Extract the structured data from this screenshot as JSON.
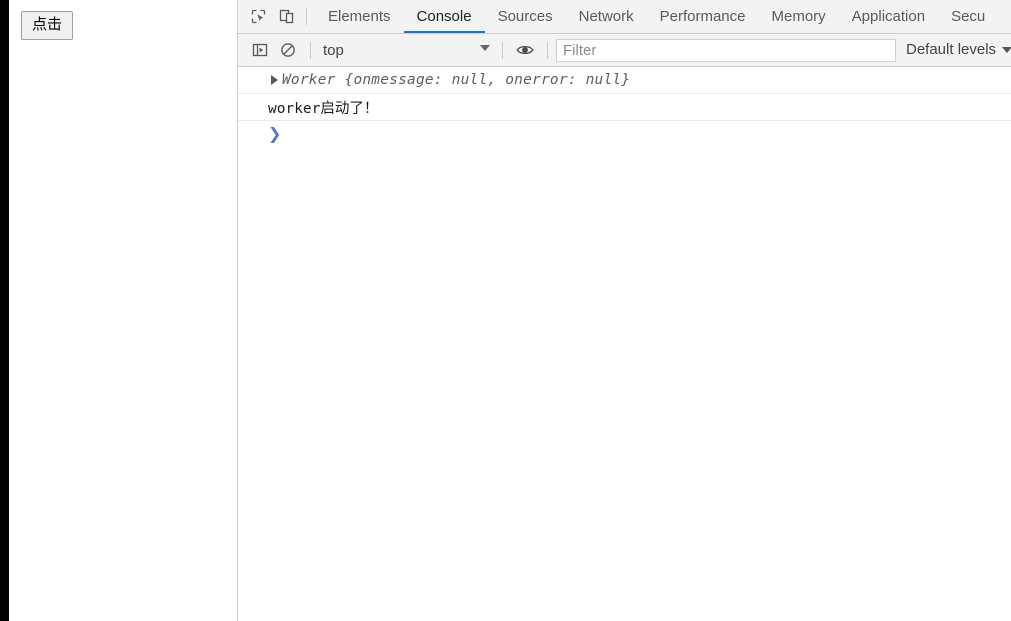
{
  "page": {
    "button_label": "点击"
  },
  "devtools": {
    "toolbar_icons": {
      "inspect": "inspect-element-icon",
      "device": "device-toolbar-icon"
    },
    "tabs": [
      {
        "label": "Elements",
        "active": false
      },
      {
        "label": "Console",
        "active": true
      },
      {
        "label": "Sources",
        "active": false
      },
      {
        "label": "Network",
        "active": false
      },
      {
        "label": "Performance",
        "active": false
      },
      {
        "label": "Memory",
        "active": false
      },
      {
        "label": "Application",
        "active": false
      },
      {
        "label": "Secu",
        "active": false
      }
    ],
    "console_toolbar": {
      "sidebar_toggle_icon": "console-sidebar-icon",
      "clear_icon": "clear-console-icon",
      "context_value": "top",
      "eye_icon": "live-expression-icon",
      "filter_placeholder": "Filter",
      "filter_value": "",
      "levels_label": "Default levels"
    },
    "messages": [
      {
        "kind": "object",
        "expandable": true,
        "text": "Worker {onmessage: null, onerror: null}"
      },
      {
        "kind": "log",
        "expandable": false,
        "text": "worker启动了！"
      }
    ],
    "prompt": {
      "chevron": "❯"
    }
  },
  "colors": {
    "accent": "#1a73e8",
    "prompt": "#4a7ad6",
    "toolbar_bg": "#f3f3f3",
    "border": "#cdcdcd",
    "window_edge": "#000000"
  }
}
